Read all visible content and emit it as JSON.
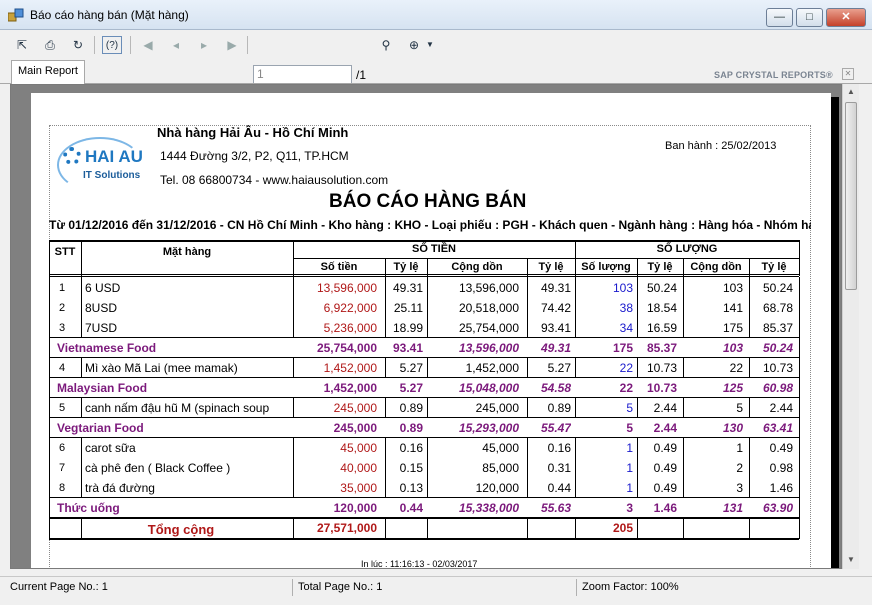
{
  "window": {
    "title": "Báo cáo hàng bán (Mặt hàng)"
  },
  "toolbar": {
    "page_value": "1",
    "page_total": "/1",
    "brand": "SAP CRYSTAL REPORTS®"
  },
  "tabs": [
    {
      "label": "Main Report"
    }
  ],
  "report": {
    "logo_brand": "HAI AU",
    "logo_sub": "IT Solutions",
    "company": "Nhà hàng Hải Âu - Hồ Chí Minh",
    "address": "1444 Đường 3/2, P2, Q11, TP.HCM",
    "phone": "Tel. 08 66800734 - www.haiausolution.com",
    "issued": "Ban hành : 25/02/2013",
    "title": "BÁO CÁO HÀNG BÁN",
    "filter": "Từ 01/12/2016 đến 31/12/2016 - CN Hồ Chí Minh - Kho hàng : KHO - Loại phiếu : PGH - Khách quen - Ngành hàng : Hàng hóa - Nhóm hà",
    "headers": {
      "stt": "STT",
      "item": "Mặt hàng",
      "money_group": "SỐ TIỀN",
      "qty_group": "SỐ LƯỢNG",
      "amount": "Số tiền",
      "ratio1": "Tỷ lệ",
      "cumulative1": "Cộng dồn",
      "ratio2": "Tỷ lệ",
      "quantity": "Số lượng",
      "ratio3": "Tỷ lệ",
      "cumulative2": "Cộng dồn",
      "ratio4": "Tỷ lệ"
    },
    "rows": [
      {
        "type": "item",
        "stt": "1",
        "name": "6 USD",
        "amount": "13,596,000",
        "r1": "49.31",
        "cum1": "13,596,000",
        "r2": "49.31",
        "qty": "103",
        "r3": "50.24",
        "cum2": "103",
        "r4": "50.24"
      },
      {
        "type": "item",
        "stt": "2",
        "name": "8USD",
        "amount": "6,922,000",
        "r1": "25.11",
        "cum1": "20,518,000",
        "r2": "74.42",
        "qty": "38",
        "r3": "18.54",
        "cum2": "141",
        "r4": "68.78"
      },
      {
        "type": "item",
        "stt": "3",
        "name": "7USD",
        "amount": "5,236,000",
        "r1": "18.99",
        "cum1": "25,754,000",
        "r2": "93.41",
        "qty": "34",
        "r3": "16.59",
        "cum2": "175",
        "r4": "85.37"
      },
      {
        "type": "group",
        "name": "Vietnamese Food",
        "amount": "25,754,000",
        "r1": "93.41",
        "cum1": "13,596,000",
        "r2": "49.31",
        "qty": "175",
        "r3": "85.37",
        "cum2": "103",
        "r4": "50.24"
      },
      {
        "type": "item",
        "stt": "4",
        "name": "Mì xào Mã Lai (mee mamak)",
        "amount": "1,452,000",
        "r1": "5.27",
        "cum1": "1,452,000",
        "r2": "5.27",
        "qty": "22",
        "r3": "10.73",
        "cum2": "22",
        "r4": "10.73"
      },
      {
        "type": "group",
        "name": "Malaysian Food",
        "amount": "1,452,000",
        "r1": "5.27",
        "cum1": "15,048,000",
        "r2": "54.58",
        "qty": "22",
        "r3": "10.73",
        "cum2": "125",
        "r4": "60.98"
      },
      {
        "type": "item",
        "stt": "5",
        "name": "canh nấm đậu hũ M (spinach soup",
        "amount": "245,000",
        "r1": "0.89",
        "cum1": "245,000",
        "r2": "0.89",
        "qty": "5",
        "r3": "2.44",
        "cum2": "5",
        "r4": "2.44"
      },
      {
        "type": "group",
        "name": "Vegtarian Food",
        "amount": "245,000",
        "r1": "0.89",
        "cum1": "15,293,000",
        "r2": "55.47",
        "qty": "5",
        "r3": "2.44",
        "cum2": "130",
        "r4": "63.41"
      },
      {
        "type": "item",
        "stt": "6",
        "name": "carot sữa",
        "amount": "45,000",
        "r1": "0.16",
        "cum1": "45,000",
        "r2": "0.16",
        "qty": "1",
        "r3": "0.49",
        "cum2": "1",
        "r4": "0.49"
      },
      {
        "type": "item",
        "stt": "7",
        "name": "cà phê đen ( Black Coffee )",
        "amount": "40,000",
        "r1": "0.15",
        "cum1": "85,000",
        "r2": "0.31",
        "qty": "1",
        "r3": "0.49",
        "cum2": "2",
        "r4": "0.98"
      },
      {
        "type": "item",
        "stt": "8",
        "name": "trà đá đường",
        "amount": "35,000",
        "r1": "0.13",
        "cum1": "120,000",
        "r2": "0.44",
        "qty": "1",
        "r3": "0.49",
        "cum2": "3",
        "r4": "1.46"
      },
      {
        "type": "group",
        "name": "Thức uống",
        "amount": "120,000",
        "r1": "0.44",
        "cum1": "15,338,000",
        "r2": "55.63",
        "qty": "3",
        "r3": "1.46",
        "cum2": "131",
        "r4": "63.90"
      },
      {
        "type": "total",
        "name": "Tổng cộng",
        "amount": "27,571,000",
        "qty": "205"
      }
    ],
    "printed_at": "In lúc : 11:16:13 - 02/03/2017"
  },
  "statusbar": {
    "current_page": "Current Page No.: 1",
    "total_page": "Total Page No.: 1",
    "zoom": "Zoom Factor: 100%"
  }
}
